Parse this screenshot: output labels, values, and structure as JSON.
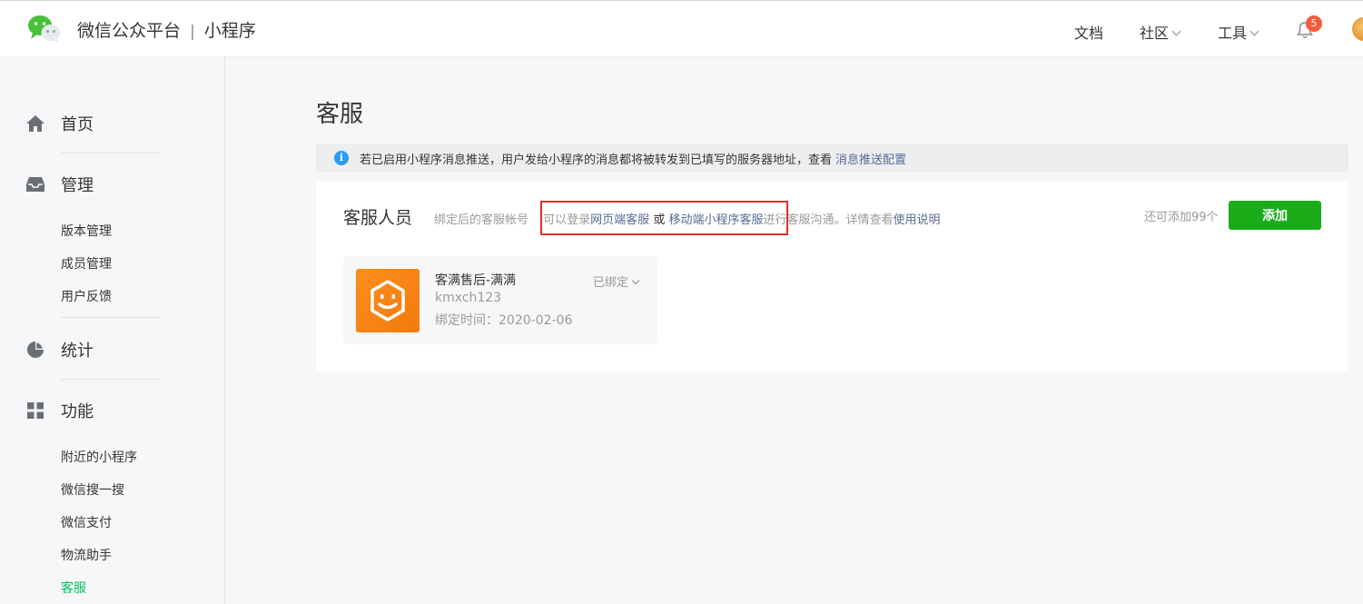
{
  "header": {
    "brand": "微信公众平台",
    "separator": "|",
    "product": "小程序",
    "nav": [
      {
        "label": "文档"
      },
      {
        "label": "社区"
      },
      {
        "label": "工具"
      }
    ],
    "notification_count": "5"
  },
  "sidebar": {
    "groups": [
      {
        "label": "首页",
        "icon": "home-icon"
      },
      {
        "label": "管理",
        "icon": "inbox-icon"
      },
      {
        "label": "统计",
        "icon": "pie-chart-icon"
      },
      {
        "label": "功能",
        "icon": "grid-icon"
      }
    ],
    "manage_items": [
      "版本管理",
      "成员管理",
      "用户反馈"
    ],
    "feature_items": [
      "附近的小程序",
      "微信搜一搜",
      "微信支付",
      "物流助手",
      "客服"
    ],
    "active_color": "#07c160"
  },
  "main": {
    "title": "客服",
    "notice": {
      "text": "若已启用小程序消息推送，用户发给小程序的消息都将被转发到已填写的服务器地址，查看",
      "link": "消息推送配置"
    },
    "card": {
      "title": "客服人员",
      "desc_prefix": "绑定后的客服帐号",
      "desc_login": "可以登录",
      "desc_web_link": "网页端客服",
      "desc_or": "或",
      "desc_mobile_link": "移动端小程序客服",
      "desc_suffix": "进行客服沟通。详情查看",
      "desc_help_link": "使用说明",
      "remain": "还可添加99个",
      "add_button": "添加",
      "members": [
        {
          "name": "客满售后-满满",
          "account": "kmxch123",
          "bind_time": "绑定时间：2020-02-06",
          "status": "已绑定"
        }
      ]
    }
  },
  "colors": {
    "primary_green": "#1aad19",
    "link_blue": "#576b95",
    "highlight_red": "#e0302a",
    "badge_red": "#f55a3a",
    "avatar_orange": "#fb8f1a"
  }
}
